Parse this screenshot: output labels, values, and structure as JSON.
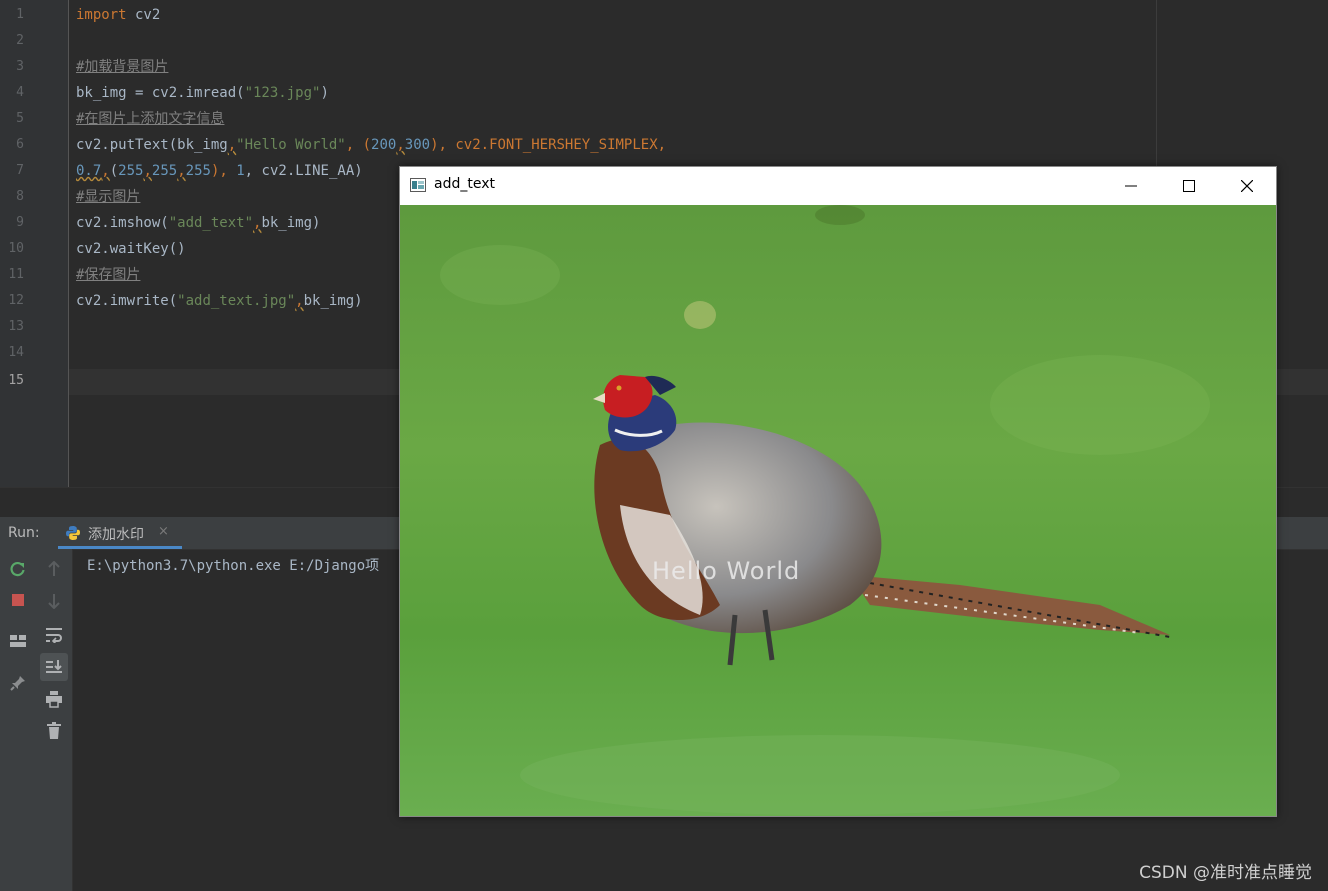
{
  "editor": {
    "line_numbers": [
      "1",
      "2",
      "3",
      "4",
      "5",
      "6",
      "7",
      "8",
      "9",
      "10",
      "11",
      "12",
      "13",
      "14",
      "15"
    ],
    "lines": {
      "l1_kw": "import",
      "l1_rest": " cv2",
      "l3": "#加载背景图片",
      "l4_a": "bk_img = cv2.imread(",
      "l4_str": "\"123.jpg\"",
      "l4_b": ")",
      "l5": "#在图片上添加文字信息",
      "l6_a": "cv2.putText(bk_img",
      "l6_c1": ",",
      "l6_str": "\"Hello World\"",
      "l6_b": ", (",
      "l6_n1": "200",
      "l6_c2": ",",
      "l6_n2": "300",
      "l6_c": "), cv2.FONT_HERSHEY_SIMPLEX,",
      "l7_n1": "0.7",
      "l7_c1": ",",
      "l7_a": "(",
      "l7_n2": "255",
      "l7_c2": ",",
      "l7_n3": "255",
      "l7_c3": ",",
      "l7_n4": "255",
      "l7_b": "), ",
      "l7_n5": "1",
      "l7_c": ", cv2.LINE_AA)",
      "l8": "#显示图片",
      "l9_a": "cv2.imshow(",
      "l9_str": "\"add_text\"",
      "l9_c1": ",",
      "l9_b": "bk_img)",
      "l10": "cv2.waitKey()",
      "l11": "#保存图片",
      "l12_a": "cv2.imwrite(",
      "l12_str": "\"add_text.jpg\"",
      "l12_c1": ",",
      "l12_b": "bk_img)"
    }
  },
  "run_panel": {
    "label": "Run:",
    "tab_label": "添加水印",
    "tab_close": "×",
    "console_line": "E:\\python3.7\\python.exe E:/Django项"
  },
  "toolbar_icons": [
    "rerun-icon",
    "stop-icon",
    "layout-icon",
    "pin-icon",
    "up-arrow-icon",
    "down-arrow-icon",
    "soft-wrap-icon",
    "scroll-to-end-icon",
    "print-icon",
    "trash-icon"
  ],
  "window": {
    "title": "add_text",
    "image_overlay_text": "Hello World"
  },
  "watermark": "CSDN @准时准点睡觉",
  "colors": {
    "keyword": "#cc7832",
    "string": "#6a8759",
    "number": "#6897bb",
    "comment": "#808080",
    "text": "#a9b7c6"
  }
}
